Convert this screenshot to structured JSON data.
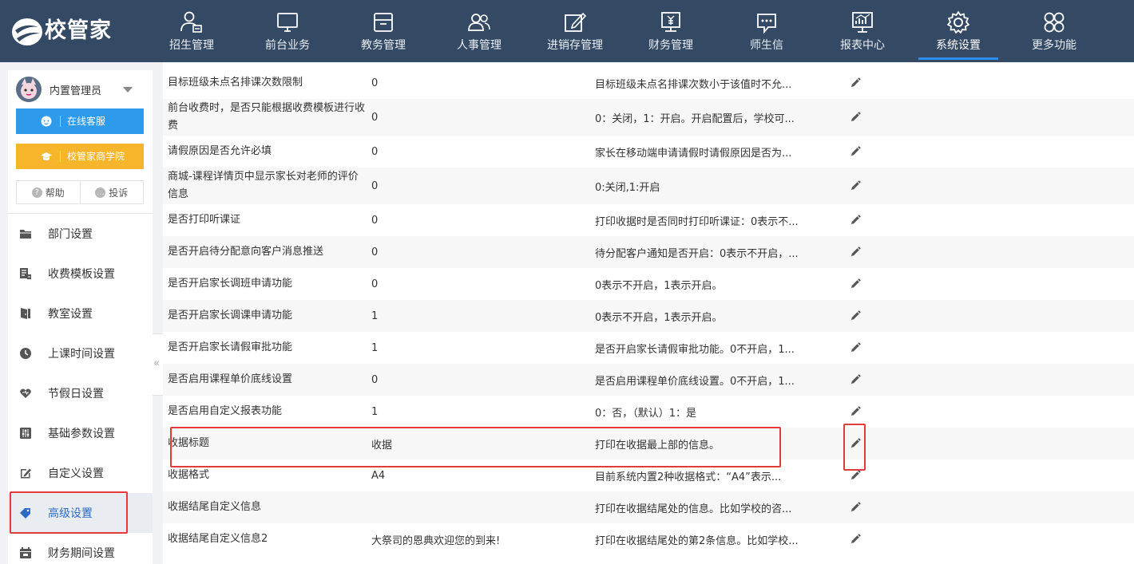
{
  "app": {
    "logo_text": "校管家",
    "brand_color": "#344a64",
    "accent_color": "#2d8cf0"
  },
  "nav": {
    "items": [
      {
        "label": "招生管理",
        "icon": "recruit-icon"
      },
      {
        "label": "前台业务",
        "icon": "monitor-icon"
      },
      {
        "label": "教务管理",
        "icon": "box-icon"
      },
      {
        "label": "人事管理",
        "icon": "people-icon"
      },
      {
        "label": "进销存管理",
        "icon": "edit-box-icon"
      },
      {
        "label": "财务管理",
        "icon": "yen-screen-icon"
      },
      {
        "label": "师生信",
        "icon": "chat-icon"
      },
      {
        "label": "报表中心",
        "icon": "chart-screen-icon"
      },
      {
        "label": "系统设置",
        "icon": "gear-icon",
        "active": true
      },
      {
        "label": "更多功能",
        "icon": "grid-clover-icon"
      }
    ]
  },
  "sidebar": {
    "user_name": "内置管理员",
    "service_button": "在线客服",
    "academy_button": "校管家商学院",
    "help_label": "帮助",
    "complaint_label": "投诉",
    "menu": [
      {
        "label": "部门设置",
        "icon": "folder-icon"
      },
      {
        "label": "收费模板设置",
        "icon": "template-icon"
      },
      {
        "label": "教室设置",
        "icon": "door-icon"
      },
      {
        "label": "上课时间设置",
        "icon": "clock-icon"
      },
      {
        "label": "节假日设置",
        "icon": "heart-icon"
      },
      {
        "label": "基础参数设置",
        "icon": "sliders-icon"
      },
      {
        "label": "自定义设置",
        "icon": "pencil-square-icon"
      },
      {
        "label": "高级设置",
        "icon": "tag-icon",
        "active": true
      },
      {
        "label": "财务期间设置",
        "icon": "calendar-icon"
      }
    ],
    "collapse_glyph": "«"
  },
  "table": {
    "rows": [
      {
        "name": "目标班级未点名排课次数限制",
        "value": "0",
        "desc": "目标班级未点名排课次数小于该值时不允..."
      },
      {
        "name": "前台收费时，是否只能根据收费模板进行收费",
        "value": "0",
        "desc": "0：关闭，1：开启。开启配置后，学校可..."
      },
      {
        "name": "请假原因是否允许必填",
        "value": "0",
        "desc": "家长在移动端申请请假时请假原因是否为..."
      },
      {
        "name": "商城-课程详情页中显示家长对老师的评价信息",
        "value": "0",
        "desc": "0:关闭,1:开启"
      },
      {
        "name": "是否打印听课证",
        "value": "0",
        "desc": "打印收据时是否同时打印听课证：0表示不..."
      },
      {
        "name": "是否开启待分配意向客户消息推送",
        "value": "0",
        "desc": "待分配客户通知是否开启：0表示不开启，..."
      },
      {
        "name": "是否开启家长调班申请功能",
        "value": "0",
        "desc": "0表示不开启，1表示开启。"
      },
      {
        "name": "是否开启家长调课申请功能",
        "value": "1",
        "desc": "0表示不开启，1表示开启。"
      },
      {
        "name": "是否开启家长请假审批功能",
        "value": "1",
        "desc": "是否开启家长请假审批功能。0不开启，1..."
      },
      {
        "name": "是否启用课程单价底线设置",
        "value": "0",
        "desc": "是否启用课程单价底线设置。0不开启，1..."
      },
      {
        "name": "是否启用自定义报表功能",
        "value": "1",
        "desc": "0：否，（默认）1：是"
      },
      {
        "name": "收据标题",
        "value": "收据",
        "desc": "打印在收据最上部的信息。"
      },
      {
        "name": "收据格式",
        "value": "A4",
        "desc": "目前系统内置2种收据格式：“A4”表示..."
      },
      {
        "name": "收据结尾自定义信息",
        "value": "",
        "desc": "打印在收据结尾处的信息。比如学校的咨..."
      },
      {
        "name": "收据结尾自定义信息2",
        "value": "大祭司的恩典欢迎您的到来!",
        "desc": "打印在收据结尾处的第2条信息。比如学校..."
      }
    ]
  }
}
